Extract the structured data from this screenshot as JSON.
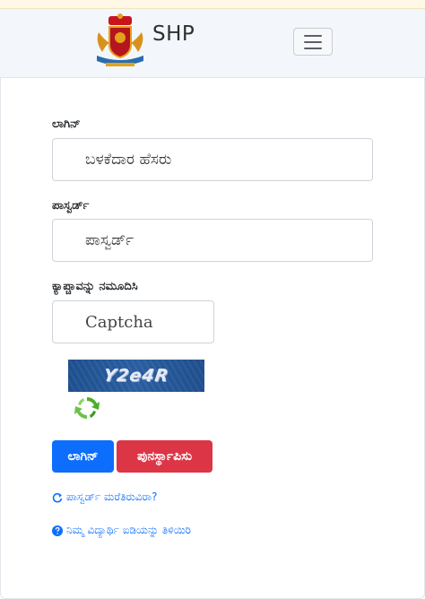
{
  "header": {
    "brand_text": "SHP",
    "emblem_icon": "karnataka-emblem-icon",
    "menu_icon": "hamburger-menu-icon"
  },
  "form": {
    "login_label": "ಲಾಗಿನ್",
    "login_placeholder": "ಬಳಕೆದಾರ ಹೆಸರು",
    "password_label": "ಪಾಸ್ವರ್ಡ್",
    "password_placeholder": "ಪಾಸ್ವರ್ಡ್",
    "captcha_label": "ಕ್ಯಾಪ್ಚಾವನ್ನು ನಮೂದಿಸಿ",
    "captcha_placeholder": "Captcha",
    "captcha_text": "Y2e4R",
    "refresh_icon": "captcha-refresh-icon"
  },
  "buttons": {
    "login": "ಲಾಗಿನ್",
    "reset": "ಪುನರ್ಸ್ಥಾಪಿಸು"
  },
  "links": {
    "forgot_password": "ಪಾಸ್ವರ್ಡ್ ಮರೆತಿರುವಿರಾ?",
    "know_student_id": "ನಿಮ್ಮ ವಿದ್ಯಾರ್ಥಿ ಐಡಿಯನ್ನು ತಿಳಿಯಿರಿ"
  },
  "colors": {
    "primary": "#0d6efd",
    "danger": "#dc3545",
    "navbar_bg": "#f3f6fb"
  }
}
